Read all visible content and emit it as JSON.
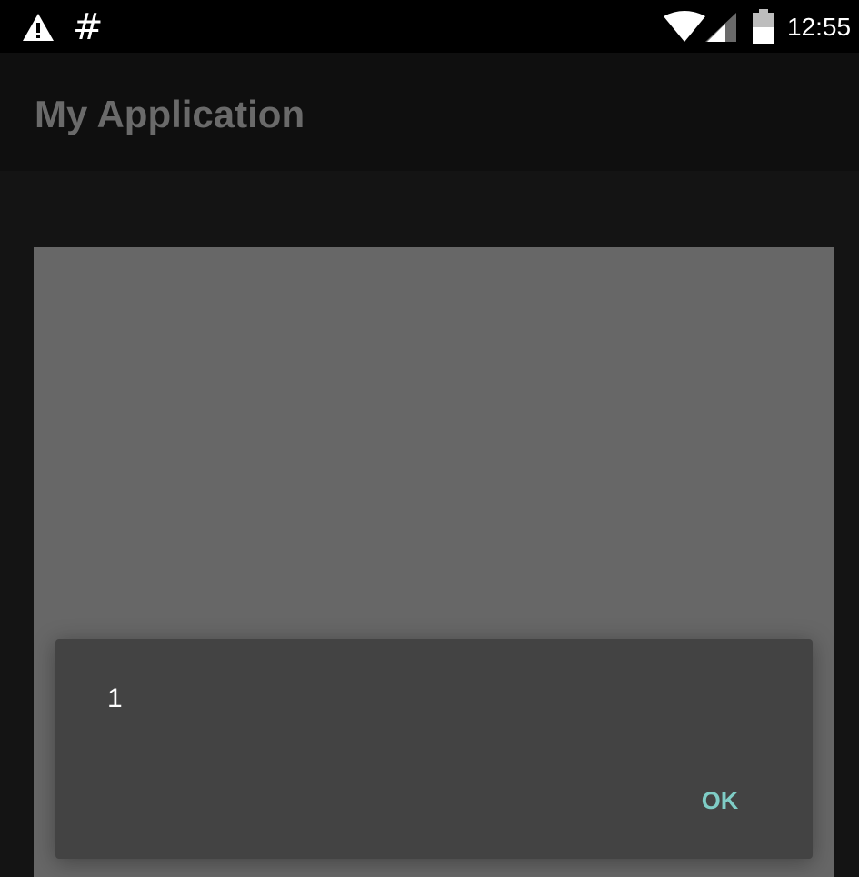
{
  "status_bar": {
    "time": "12:55",
    "notification_hash": "#",
    "icons": [
      "warning-icon",
      "wifi-icon",
      "cell-signal-icon",
      "battery-icon"
    ]
  },
  "app_bar": {
    "title": "My Application"
  },
  "dialog": {
    "message": "1",
    "ok_label": "OK",
    "accent_color": "#7fcdc6"
  },
  "colors": {
    "status_bar_bg": "#000000",
    "app_bar_bg": "#0f0f0f",
    "background": "#141414",
    "card_bg": "#676767",
    "dialog_bg": "#434343",
    "title_text": "#6a6a6a"
  }
}
